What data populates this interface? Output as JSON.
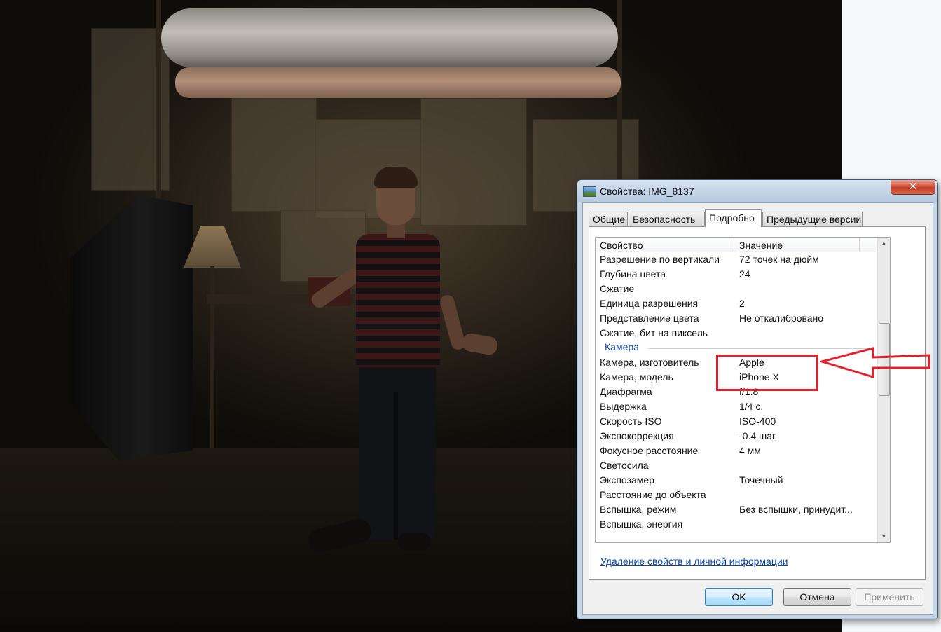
{
  "dialog": {
    "title": "Свойства: IMG_8137",
    "close_symbol": "✕",
    "tabs": [
      {
        "label": "Общие"
      },
      {
        "label": "Безопасность"
      },
      {
        "label": "Подробно"
      },
      {
        "label": "Предыдущие версии"
      }
    ],
    "active_tab": "Подробно",
    "list": {
      "col_property": "Свойство",
      "col_value": "Значение",
      "rows_before_group": [
        {
          "property": "Разрешение по вертикали",
          "value": "72 точек на дюйм"
        },
        {
          "property": "Глубина цвета",
          "value": "24"
        },
        {
          "property": "Сжатие",
          "value": ""
        },
        {
          "property": "Единица разрешения",
          "value": "2"
        },
        {
          "property": "Представление цвета",
          "value": "Не откалибровано"
        },
        {
          "property": "Сжатие, бит на пиксель",
          "value": ""
        }
      ],
      "group_label": "Камера",
      "rows_after_group": [
        {
          "property": "Камера, изготовитель",
          "value": "Apple"
        },
        {
          "property": "Камера, модель",
          "value": "iPhone X"
        },
        {
          "property": "Диафрагма",
          "value": "f/1.8"
        },
        {
          "property": "Выдержка",
          "value": "1/4 с."
        },
        {
          "property": "Скорость ISO",
          "value": "ISO-400"
        },
        {
          "property": "Экспокоррекция",
          "value": "-0.4 шаг."
        },
        {
          "property": "Фокусное расстояние",
          "value": "4 мм"
        },
        {
          "property": "Светосила",
          "value": ""
        },
        {
          "property": "Экспозамер",
          "value": "Точечный"
        },
        {
          "property": "Расстояние до объекта",
          "value": ""
        },
        {
          "property": "Вспышка, режим",
          "value": "Без вспышки, принудит..."
        },
        {
          "property": "Вспышка, энергия",
          "value": ""
        }
      ]
    },
    "remove_link": "Удаление свойств и личной информации",
    "buttons": {
      "ok": "OK",
      "cancel": "Отмена",
      "apply": "Применить"
    }
  },
  "annotation": {
    "color": "#e4212b"
  }
}
